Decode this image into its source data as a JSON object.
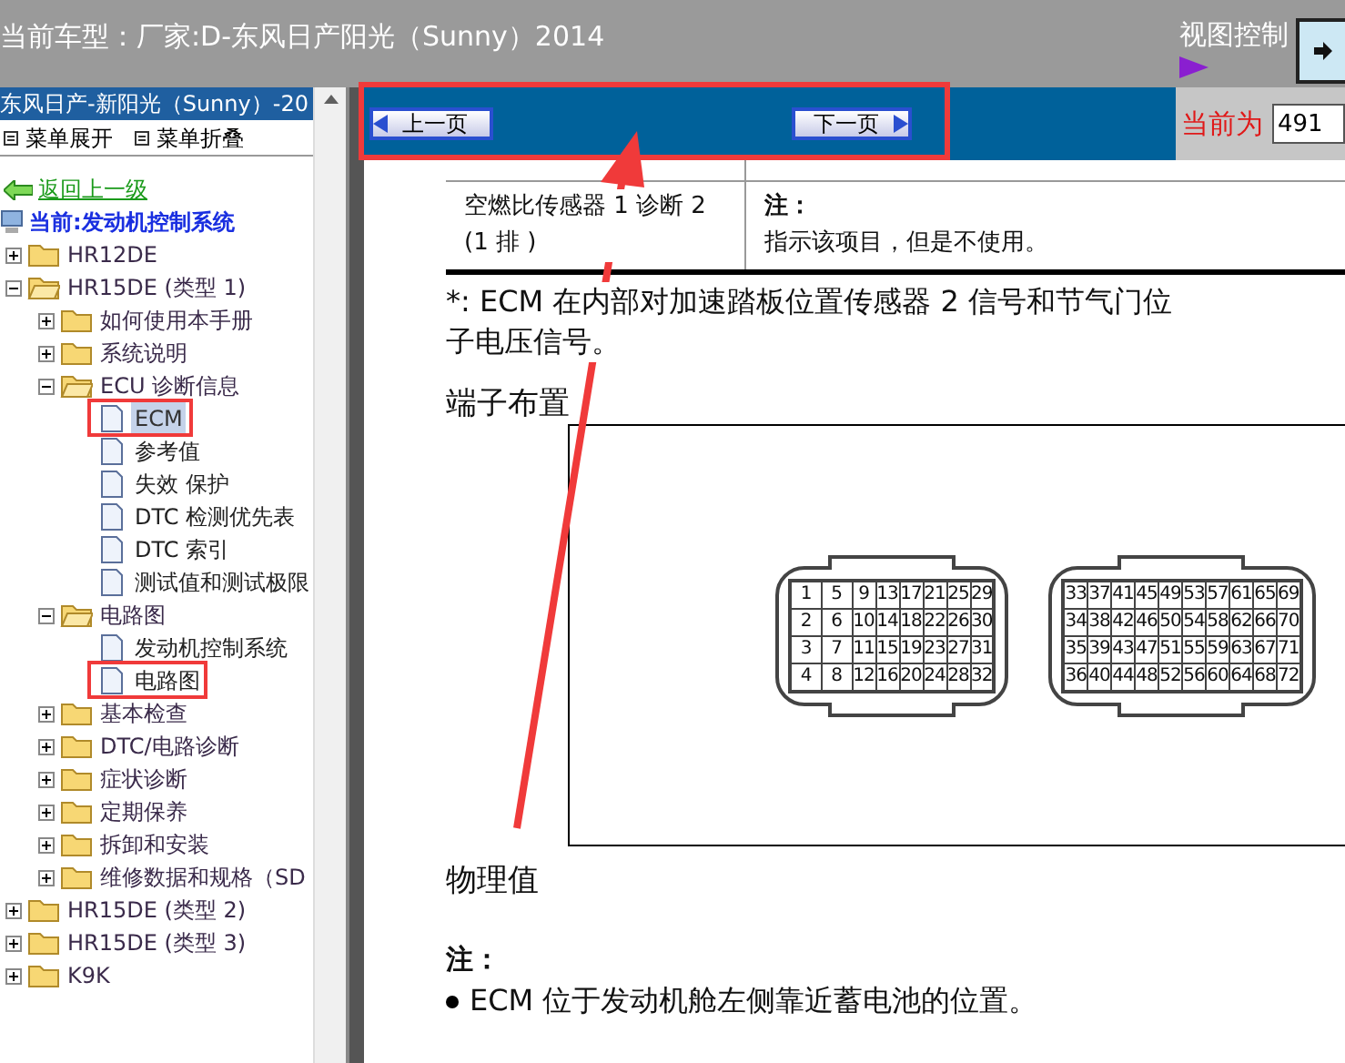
{
  "header": {
    "title": "当前车型：厂家:D-东风日产阳光（Sunny）2014",
    "view_control": "视图控制"
  },
  "sidebar": {
    "model": "东风日产-新阳光（Sunny）-20",
    "expand_all": "菜单展开",
    "collapse_all": "菜单折叠",
    "back_link": "返回上一级",
    "current": "当前:发动机控制系统",
    "tree": [
      {
        "label": "HR12DE",
        "kind": "folder",
        "expanded": false,
        "selected": false
      },
      {
        "label": "HR15DE (类型 1)",
        "kind": "folder",
        "expanded": true,
        "selected": false,
        "children": [
          {
            "label": "如何使用本手册",
            "kind": "folder",
            "expanded": false,
            "selected": false
          },
          {
            "label": "系统说明",
            "kind": "folder",
            "expanded": false,
            "selected": false
          },
          {
            "label": "ECU 诊断信息",
            "kind": "folder",
            "expanded": true,
            "selected": false,
            "children": [
              {
                "label": "ECM",
                "kind": "page",
                "selected": true
              },
              {
                "label": "参考值",
                "kind": "page",
                "selected": false
              },
              {
                "label": "失效 保护",
                "kind": "page",
                "selected": false
              },
              {
                "label": "DTC 检测优先表",
                "kind": "page",
                "selected": false
              },
              {
                "label": "DTC 索引",
                "kind": "page",
                "selected": false
              },
              {
                "label": "测试值和测试极限",
                "kind": "page",
                "selected": false
              }
            ]
          },
          {
            "label": "电路图",
            "kind": "folder",
            "expanded": true,
            "selected": false,
            "children": [
              {
                "label": "发动机控制系统",
                "kind": "page",
                "selected": false
              },
              {
                "label": "电路图",
                "kind": "page",
                "selected": false
              }
            ]
          },
          {
            "label": "基本检查",
            "kind": "folder",
            "expanded": false,
            "selected": false
          },
          {
            "label": "DTC/电路诊断",
            "kind": "folder",
            "expanded": false,
            "selected": false
          },
          {
            "label": "症状诊断",
            "kind": "folder",
            "expanded": false,
            "selected": false
          },
          {
            "label": "定期保养",
            "kind": "folder",
            "expanded": false,
            "selected": false
          },
          {
            "label": "拆卸和安装",
            "kind": "folder",
            "expanded": false,
            "selected": false
          },
          {
            "label": "维修数据和规格（SD",
            "kind": "folder",
            "expanded": false,
            "selected": false
          }
        ]
      },
      {
        "label": "HR15DE (类型 2)",
        "kind": "folder",
        "expanded": false,
        "selected": false
      },
      {
        "label": "HR15DE (类型 3)",
        "kind": "folder",
        "expanded": false,
        "selected": false
      },
      {
        "label": "K9K",
        "kind": "folder",
        "expanded": false,
        "selected": false
      }
    ]
  },
  "nav": {
    "prev": "上一页",
    "next": "下一页",
    "current_label": "当前为",
    "page": "491"
  },
  "content": {
    "table_rows": [
      {
        "item": "空燃比传感器 1 诊断 2 (1 排 )",
        "note_title": "注：",
        "note": "指示该项目，但是不使用。"
      }
    ],
    "footnote_lines": [
      "*: ECM 在内部对加速踏板位置传感器 2 信号和节气门位",
      "子电压信号。"
    ],
    "terminal_heading": "端子布置",
    "connectors": [
      {
        "rows": [
          [
            "1",
            "5",
            "9",
            "13",
            "17",
            "21",
            "25",
            "29"
          ],
          [
            "2",
            "6",
            "10",
            "14",
            "18",
            "22",
            "26",
            "30"
          ],
          [
            "3",
            "7",
            "11",
            "15",
            "19",
            "23",
            "27",
            "31"
          ],
          [
            "4",
            "8",
            "12",
            "16",
            "20",
            "24",
            "28",
            "32"
          ]
        ]
      },
      {
        "rows": [
          [
            "33",
            "37",
            "41",
            "45",
            "49",
            "53",
            "57",
            "61",
            "65",
            "69"
          ],
          [
            "34",
            "38",
            "42",
            "46",
            "50",
            "54",
            "58",
            "62",
            "66",
            "70"
          ],
          [
            "35",
            "39",
            "43",
            "47",
            "51",
            "55",
            "59",
            "63",
            "67",
            "71"
          ],
          [
            "36",
            "40",
            "44",
            "48",
            "52",
            "56",
            "60",
            "64",
            "68",
            "72"
          ]
        ]
      }
    ],
    "values_heading": "物理值",
    "note_title": "注：",
    "bullets": [
      "ECM 位于发动机舱左侧靠近蓄电池的位置。"
    ]
  }
}
